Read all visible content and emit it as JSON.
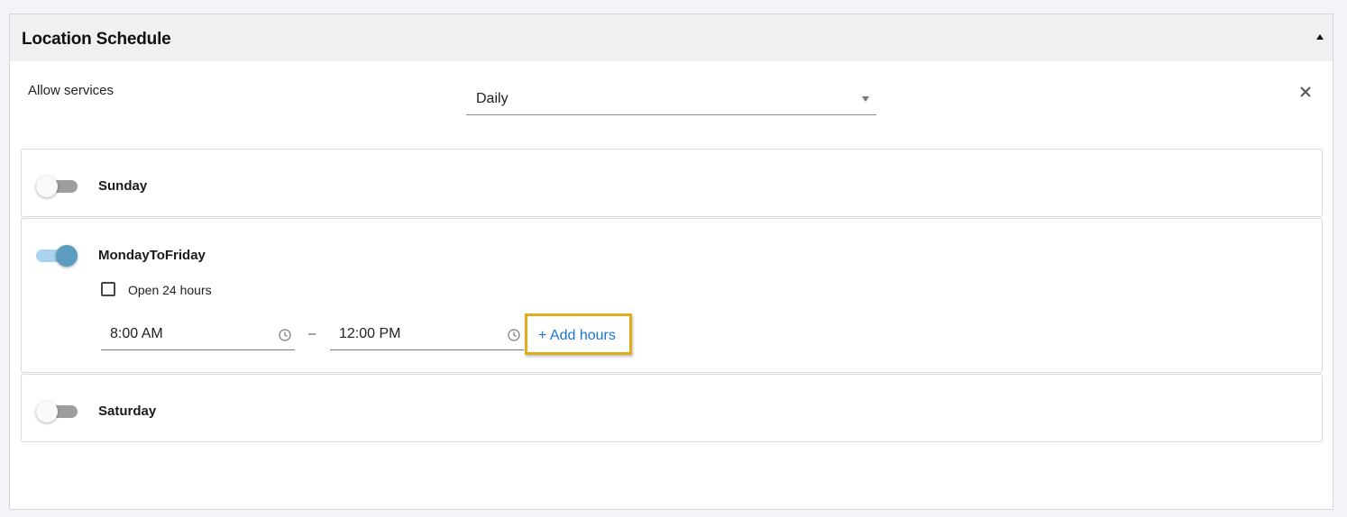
{
  "panel": {
    "title": "Location Schedule",
    "collapse_icon": "caret-up-icon"
  },
  "services": {
    "label": "Allow services",
    "select_value": "Daily",
    "close_icon": "close-icon"
  },
  "days": [
    {
      "name": "Sunday",
      "enabled": false
    },
    {
      "name": "MondayToFriday",
      "enabled": true,
      "open_24_label": "Open 24 hours",
      "open_24_checked": false,
      "start_time": "8:00 AM",
      "separator": "–",
      "end_time": "12:00 PM",
      "add_hours_label": "+ Add hours"
    },
    {
      "name": "Saturday",
      "enabled": false
    }
  ],
  "colors": {
    "toggle_on_track": "#a9d3ef",
    "toggle_on_knob": "#5b9cbf",
    "toggle_off_track": "#9e9e9e",
    "link": "#1a75d2",
    "highlight": "#e0ae1c"
  }
}
